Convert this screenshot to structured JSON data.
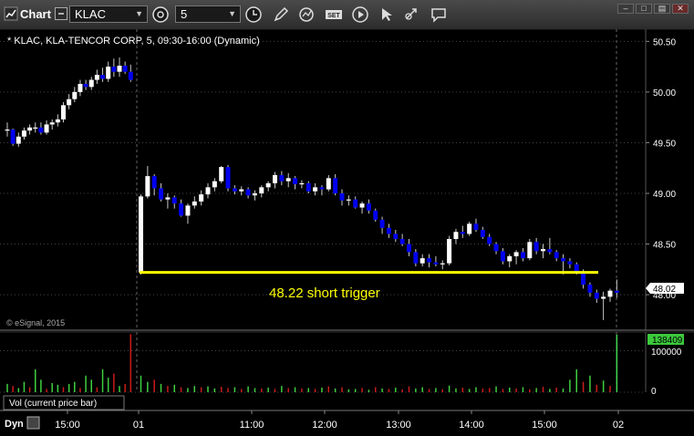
{
  "toolbar": {
    "app_title": "Chart",
    "symbol": "KLAC",
    "interval": "5",
    "icons": [
      "chart-logo-icon",
      "link-icon",
      "time-template-icon",
      "pencil-icon",
      "refresh-icon",
      "studies-icon",
      "play-icon",
      "cursor-icon",
      "comment-icon"
    ]
  },
  "chart_data": {
    "type": "candlestick",
    "title": "* KLAC, KLA-TENCOR CORP, 5, 09:30-16:00 (Dynamic)",
    "watermark": "© eSignal, 2015",
    "price_axis": {
      "ylim": [
        47.65,
        50.62
      ],
      "ticks": [
        "50.50",
        "50.00",
        "49.50",
        "49.00",
        "48.50",
        "48.00"
      ]
    },
    "last_price": "48.02",
    "time_axis": {
      "ticks": [
        "15:00",
        "01",
        "11:00",
        "12:00",
        "13:00",
        "14:00",
        "15:00",
        "02"
      ]
    },
    "trigger_line": {
      "price": 48.22,
      "label": "48.22 short trigger",
      "color": "#ffff00"
    },
    "colors": {
      "up": "#ffffff",
      "down": "#0000ee",
      "wick": "#c8c8c8",
      "vol_up": "#3fcf3f",
      "vol_down": "#cc1a1a",
      "vol_last": "#3fd64f",
      "grid": "#444444"
    },
    "candles_day1": [
      [
        49.63,
        49.7,
        49.56,
        49.63
      ],
      [
        49.63,
        49.64,
        49.47,
        49.49
      ],
      [
        49.49,
        49.6,
        49.46,
        49.56
      ],
      [
        49.56,
        49.65,
        49.53,
        49.62
      ],
      [
        49.62,
        49.68,
        49.58,
        49.65
      ],
      [
        49.65,
        49.7,
        49.6,
        49.65
      ],
      [
        49.65,
        49.7,
        49.58,
        49.6
      ],
      [
        49.6,
        49.72,
        49.58,
        49.68
      ],
      [
        49.68,
        49.73,
        49.63,
        49.7
      ],
      [
        49.7,
        49.78,
        49.66,
        49.73
      ],
      [
        49.73,
        49.9,
        49.7,
        49.87
      ],
      [
        49.87,
        49.98,
        49.83,
        49.93
      ],
      [
        49.93,
        50.05,
        49.9,
        50.0
      ],
      [
        50.0,
        50.12,
        49.96,
        50.08
      ],
      [
        50.08,
        50.12,
        50.02,
        50.05
      ],
      [
        50.05,
        50.15,
        50.02,
        50.12
      ],
      [
        50.12,
        50.22,
        50.08,
        50.17
      ],
      [
        50.17,
        50.24,
        50.1,
        50.13
      ],
      [
        50.13,
        50.3,
        50.1,
        50.25
      ],
      [
        50.25,
        50.33,
        50.15,
        50.2
      ],
      [
        50.2,
        50.34,
        50.15,
        50.26
      ],
      [
        50.26,
        50.3,
        50.18,
        50.2
      ],
      [
        50.2,
        50.27,
        50.1,
        50.12
      ]
    ],
    "candles_day2": [
      [
        48.22,
        48.99,
        48.2,
        48.97
      ],
      [
        48.97,
        49.27,
        48.95,
        49.17
      ],
      [
        49.17,
        49.19,
        48.98,
        49.05
      ],
      [
        49.05,
        49.1,
        48.92,
        48.94
      ],
      [
        48.94,
        49.0,
        48.85,
        48.96
      ],
      [
        48.96,
        48.98,
        48.85,
        48.9
      ],
      [
        48.9,
        48.94,
        48.77,
        48.78
      ],
      [
        48.78,
        48.9,
        48.7,
        48.88
      ],
      [
        48.88,
        48.97,
        48.85,
        48.92
      ],
      [
        48.92,
        49.03,
        48.88,
        48.99
      ],
      [
        48.99,
        49.1,
        48.95,
        49.06
      ],
      [
        49.06,
        49.15,
        49.02,
        49.12
      ],
      [
        49.12,
        49.27,
        49.1,
        49.26
      ],
      [
        49.26,
        49.28,
        49.02,
        49.05
      ],
      [
        49.05,
        49.08,
        48.99,
        49.02
      ],
      [
        49.02,
        49.07,
        48.98,
        49.04
      ],
      [
        49.04,
        49.06,
        48.95,
        48.98
      ],
      [
        48.98,
        49.03,
        48.93,
        49.0
      ],
      [
        49.0,
        49.08,
        48.96,
        49.06
      ],
      [
        49.06,
        49.12,
        49.02,
        49.1
      ],
      [
        49.1,
        49.21,
        49.05,
        49.18
      ],
      [
        49.18,
        49.22,
        49.08,
        49.12
      ],
      [
        49.12,
        49.2,
        49.06,
        49.15
      ],
      [
        49.15,
        49.17,
        49.04,
        49.09
      ],
      [
        49.09,
        49.13,
        49.05,
        49.1
      ],
      [
        49.1,
        49.12,
        49.0,
        49.02
      ],
      [
        49.02,
        49.1,
        48.98,
        49.06
      ],
      [
        49.06,
        49.08,
        48.98,
        49.04
      ],
      [
        49.04,
        49.18,
        49.02,
        49.15
      ],
      [
        49.15,
        49.19,
        48.98,
        49.0
      ],
      [
        49.0,
        49.04,
        48.88,
        48.93
      ],
      [
        48.93,
        48.98,
        48.88,
        48.94
      ],
      [
        48.94,
        48.97,
        48.85,
        48.86
      ],
      [
        48.86,
        48.92,
        48.8,
        48.9
      ],
      [
        48.9,
        48.94,
        48.8,
        48.83
      ],
      [
        48.83,
        48.85,
        48.72,
        48.74
      ],
      [
        48.74,
        48.77,
        48.6,
        48.66
      ],
      [
        48.66,
        48.7,
        48.56,
        48.6
      ],
      [
        48.6,
        48.64,
        48.52,
        48.55
      ],
      [
        48.55,
        48.6,
        48.48,
        48.5
      ],
      [
        48.5,
        48.55,
        48.38,
        48.42
      ],
      [
        48.42,
        48.45,
        48.28,
        48.31
      ],
      [
        48.31,
        48.4,
        48.28,
        48.36
      ],
      [
        48.36,
        48.4,
        48.27,
        48.32
      ],
      [
        48.32,
        48.38,
        48.28,
        48.3
      ],
      [
        48.3,
        48.34,
        48.25,
        48.31
      ],
      [
        48.31,
        48.58,
        48.29,
        48.55
      ],
      [
        48.55,
        48.65,
        48.5,
        48.62
      ],
      [
        48.62,
        48.68,
        48.56,
        48.6
      ],
      [
        48.6,
        48.72,
        48.58,
        48.7
      ],
      [
        48.7,
        48.75,
        48.62,
        48.64
      ],
      [
        48.64,
        48.67,
        48.55,
        48.57
      ],
      [
        48.57,
        48.6,
        48.48,
        48.5
      ],
      [
        48.5,
        48.52,
        48.4,
        48.43
      ],
      [
        48.43,
        48.46,
        48.3,
        48.33
      ],
      [
        48.33,
        48.4,
        48.27,
        48.38
      ],
      [
        48.38,
        48.44,
        48.3,
        48.42
      ],
      [
        48.42,
        48.46,
        48.33,
        48.36
      ],
      [
        48.36,
        48.55,
        48.34,
        48.52
      ],
      [
        48.52,
        48.56,
        48.4,
        48.43
      ],
      [
        48.43,
        48.5,
        48.36,
        48.45
      ],
      [
        48.45,
        48.56,
        48.4,
        48.42
      ],
      [
        48.42,
        48.44,
        48.33,
        48.36
      ],
      [
        48.36,
        48.4,
        48.2,
        48.33
      ],
      [
        48.33,
        48.36,
        48.26,
        48.3
      ],
      [
        48.3,
        48.32,
        48.2,
        48.22
      ],
      [
        48.22,
        48.25,
        48.06,
        48.1
      ],
      [
        48.1,
        48.12,
        47.98,
        48.02
      ],
      [
        48.02,
        48.05,
        47.92,
        47.96
      ],
      [
        47.96,
        48.03,
        47.75,
        47.98
      ],
      [
        47.98,
        48.06,
        47.93,
        48.04
      ],
      [
        48.04,
        48.15,
        47.97,
        48.02
      ]
    ],
    "volume_panel": {
      "label": "Vol (current price bar)",
      "last_value": "138409",
      "ticks": [
        "100000",
        "0"
      ],
      "ylim": [
        0,
        145000
      ],
      "day1_bars": [
        [
          20000,
          1
        ],
        [
          15000,
          0
        ],
        [
          10000,
          1
        ],
        [
          25000,
          1
        ],
        [
          12000,
          0
        ],
        [
          55000,
          1
        ],
        [
          30000,
          1
        ],
        [
          8000,
          0
        ],
        [
          22000,
          1
        ],
        [
          18000,
          1
        ],
        [
          12000,
          0
        ],
        [
          20000,
          1
        ],
        [
          25000,
          1
        ],
        [
          10000,
          0
        ],
        [
          40000,
          1
        ],
        [
          30000,
          1
        ],
        [
          12000,
          0
        ],
        [
          55000,
          1
        ],
        [
          35000,
          1
        ],
        [
          45000,
          0
        ],
        [
          15000,
          1
        ],
        [
          20000,
          0
        ],
        [
          140000,
          0
        ]
      ],
      "day2_bars": [
        [
          40000,
          1
        ],
        [
          25000,
          1
        ],
        [
          30000,
          0
        ],
        [
          20000,
          1
        ],
        [
          15000,
          0
        ],
        [
          18000,
          1
        ],
        [
          12000,
          0
        ],
        [
          10000,
          1
        ],
        [
          15000,
          1
        ],
        [
          12000,
          0
        ],
        [
          14000,
          1
        ],
        [
          9000,
          1
        ],
        [
          13000,
          0
        ],
        [
          10000,
          0
        ],
        [
          12000,
          1
        ],
        [
          8000,
          0
        ],
        [
          14000,
          1
        ],
        [
          10000,
          1
        ],
        [
          9000,
          0
        ],
        [
          11000,
          1
        ],
        [
          8000,
          0
        ],
        [
          15000,
          1
        ],
        [
          10000,
          0
        ],
        [
          12000,
          1
        ],
        [
          9000,
          0
        ],
        [
          10000,
          1
        ],
        [
          8000,
          0
        ],
        [
          11000,
          1
        ],
        [
          14000,
          0
        ],
        [
          9000,
          1
        ],
        [
          12000,
          0
        ],
        [
          7000,
          1
        ],
        [
          8000,
          1
        ],
        [
          10000,
          0
        ],
        [
          6000,
          1
        ],
        [
          12000,
          0
        ],
        [
          9000,
          1
        ],
        [
          8000,
          0
        ],
        [
          11000,
          1
        ],
        [
          7000,
          0
        ],
        [
          14000,
          0
        ],
        [
          9000,
          1
        ],
        [
          12000,
          1
        ],
        [
          8000,
          0
        ],
        [
          10000,
          1
        ],
        [
          7000,
          0
        ],
        [
          16000,
          1
        ],
        [
          9000,
          1
        ],
        [
          11000,
          0
        ],
        [
          8000,
          1
        ],
        [
          12000,
          1
        ],
        [
          9000,
          0
        ],
        [
          10000,
          0
        ],
        [
          14000,
          1
        ],
        [
          8000,
          0
        ],
        [
          11000,
          1
        ],
        [
          9000,
          0
        ],
        [
          12000,
          1
        ],
        [
          7000,
          0
        ],
        [
          10000,
          1
        ],
        [
          13000,
          0
        ],
        [
          8000,
          1
        ],
        [
          11000,
          0
        ],
        [
          9000,
          1
        ],
        [
          30000,
          1
        ],
        [
          55000,
          1
        ],
        [
          25000,
          0
        ],
        [
          40000,
          1
        ],
        [
          18000,
          0
        ],
        [
          28000,
          1
        ],
        [
          15000,
          0
        ],
        [
          138409,
          1
        ]
      ]
    }
  }
}
